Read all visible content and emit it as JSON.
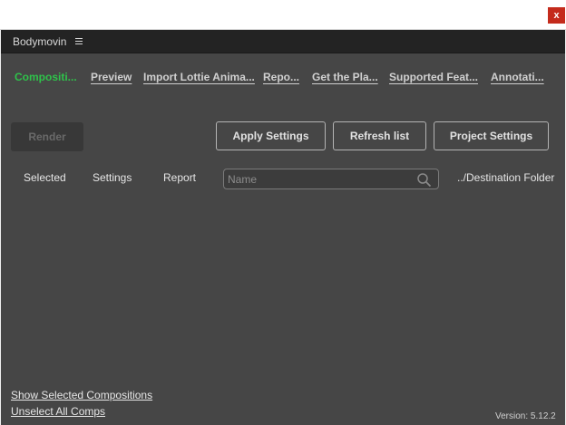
{
  "window": {
    "close_glyph": "x"
  },
  "panel": {
    "title": "Bodymovin",
    "menu_icon": "hamburger-menu-icon"
  },
  "tabs": [
    {
      "label": "Compositi...",
      "active": true
    },
    {
      "label": "Preview"
    },
    {
      "label": "Import Lottie Anima..."
    },
    {
      "label": "Repo..."
    },
    {
      "label": "Get the Pla..."
    },
    {
      "label": "Supported Feat..."
    },
    {
      "label": "Annotati..."
    }
  ],
  "toolbar": {
    "render_label": "Render",
    "apply_settings_label": "Apply Settings",
    "refresh_list_label": "Refresh list",
    "project_settings_label": "Project Settings"
  },
  "columns": {
    "selected": "Selected",
    "settings": "Settings",
    "report": "Report",
    "destination": "../Destination Folder"
  },
  "search": {
    "placeholder": "Name",
    "value": ""
  },
  "footer": {
    "show_selected": "Show Selected Compositions",
    "unselect_all": "Unselect All Comps",
    "version": "Version: 5.12.2"
  },
  "colors": {
    "panel_bg": "#464646",
    "header_bg": "#232323",
    "active_tab": "#2ec24a",
    "close_button": "#c42b1c"
  }
}
